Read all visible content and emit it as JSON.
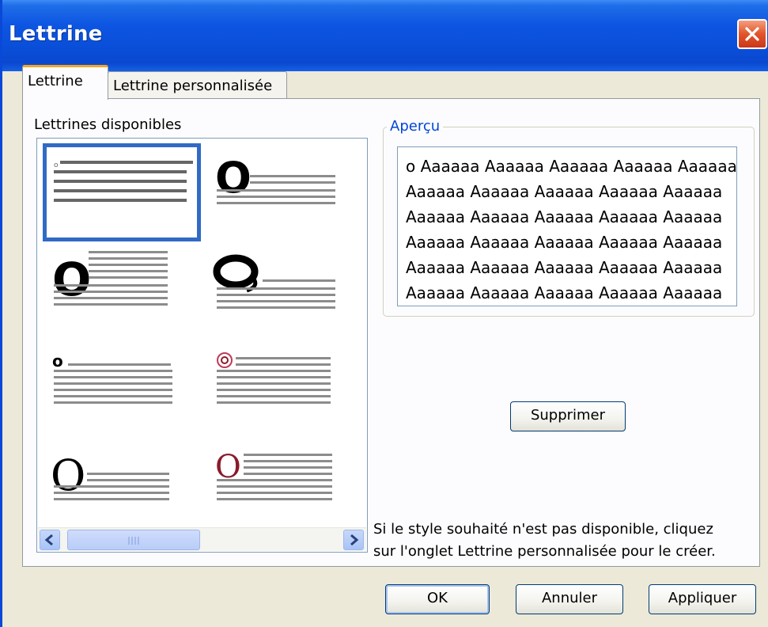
{
  "window": {
    "title": "Lettrine"
  },
  "tabs": [
    {
      "label": "Lettrine",
      "active": true
    },
    {
      "label": "Lettrine personnalisée",
      "active": false
    }
  ],
  "available": {
    "label": "Lettrines disponibles",
    "styles": [
      {
        "id": "none-inline",
        "selected": true
      },
      {
        "id": "dropped-bold"
      },
      {
        "id": "dropped-large"
      },
      {
        "id": "dropped-ornate"
      },
      {
        "id": "small-bold"
      },
      {
        "id": "circled-red"
      },
      {
        "id": "dropped-serif-black"
      },
      {
        "id": "dropped-serif-red"
      }
    ]
  },
  "preview": {
    "legend": "Aperçu",
    "lines": [
      "o Aaaaaa Aaaaaa Aaaaaa Aaaaaa Aaaaaa",
      "Aaaaaa Aaaaaa Aaaaaa Aaaaaa Aaaaaa",
      "Aaaaaa Aaaaaa Aaaaaa Aaaaaa Aaaaaa",
      "Aaaaaa Aaaaaa Aaaaaa Aaaaaa Aaaaaa",
      "Aaaaaa Aaaaaa Aaaaaa Aaaaaa Aaaaaa",
      "Aaaaaa Aaaaaa Aaaaaa Aaaaaa Aaaaaa"
    ]
  },
  "buttons": {
    "delete": "Supprimer",
    "ok": "OK",
    "cancel": "Annuler",
    "apply": "Appliquer"
  },
  "hint": {
    "line1": "Si le style souhaité n'est pas disponible, cliquez",
    "line2": "sur l'onglet Lettrine personnalisée pour le créer."
  },
  "colors": {
    "titlebar": "#0a4fd9",
    "selection": "#316ac5",
    "legend": "#0046d5",
    "accent_red": "#8b1a2b",
    "close": "#e2542b"
  },
  "icons": {
    "close": "close-icon",
    "scroll_left": "arrow-left-icon",
    "scroll_right": "arrow-right-icon",
    "scroll_grip": "grip-icon"
  }
}
